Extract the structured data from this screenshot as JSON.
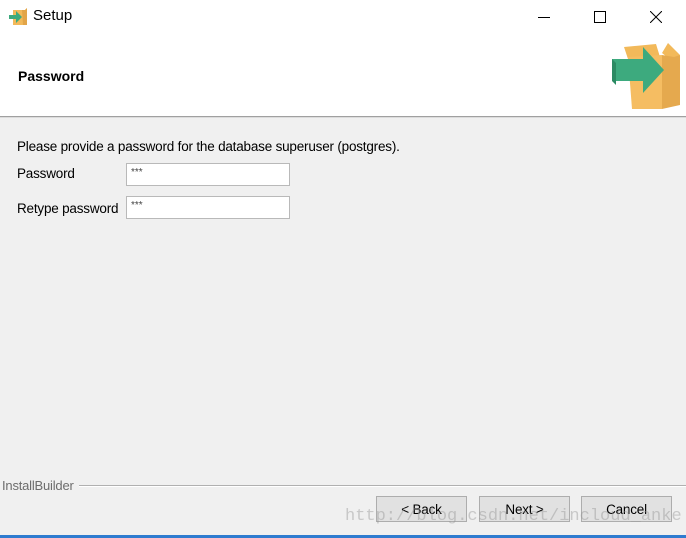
{
  "window": {
    "title": "Setup",
    "controls": {
      "minimize": "minimize",
      "maximize": "maximize",
      "close": "close"
    }
  },
  "header": {
    "title": "Password",
    "icon": "install-box-arrow-icon"
  },
  "content": {
    "intro": "Please provide a password for the database superuser (postgres).",
    "fields": [
      {
        "label": "Password",
        "value": "***"
      },
      {
        "label": "Retype password",
        "value": "***"
      }
    ]
  },
  "footer": {
    "group_label": "InstallBuilder",
    "buttons": {
      "back": "< Back",
      "next": "Next >",
      "cancel": "Cancel"
    },
    "watermark": "http://blog.csdn.net/incloud_anke"
  },
  "colors": {
    "accent": "#2e7bcf",
    "arrow": "#3daa7e",
    "box": "#f2b95a"
  }
}
